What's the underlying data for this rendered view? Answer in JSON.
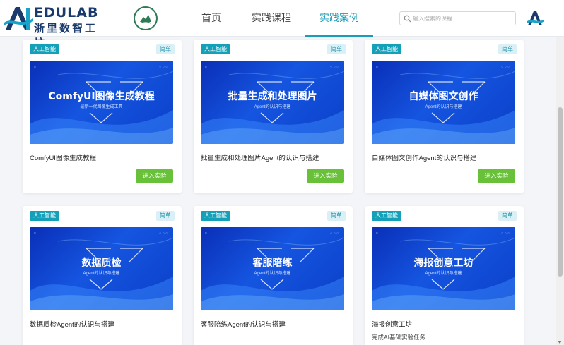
{
  "header": {
    "logo_en": "EDULAB",
    "logo_cn": "浙里数智工坊",
    "nav": [
      {
        "label": "首页",
        "active": false
      },
      {
        "label": "实践课程",
        "active": false
      },
      {
        "label": "实践案例",
        "active": true
      }
    ],
    "search_placeholder": "输入搜索的课程..."
  },
  "colors": {
    "accent": "#1b9cb8",
    "category_tag": "#14a0b8",
    "level_tag_bg": "#d9f1f6",
    "enter_button": "#69c13a",
    "cover_blue": "#1555e0"
  },
  "cards": [
    {
      "category": "人工智能",
      "level": "简单",
      "cover_title": "ComfyUI图像生成教程",
      "cover_subtitle": "——最新一代图像生成工具——",
      "title": "ComfyUI图像生成教程",
      "subtitle": "",
      "button": "进入实验"
    },
    {
      "category": "人工智能",
      "level": "简单",
      "cover_title": "批量生成和处理图片",
      "cover_subtitle": "Agent的认识与搭建",
      "title": "批量生成和处理图片Agent的认识与搭建",
      "subtitle": "",
      "button": "进入实验"
    },
    {
      "category": "人工智能",
      "level": "简单",
      "cover_title": "自媒体图文创作",
      "cover_subtitle": "Agent的认识与搭建",
      "title": "自媒体图文创作Agent的认识与搭建",
      "subtitle": "",
      "button": "进入实验"
    },
    {
      "category": "人工智能",
      "level": "简单",
      "cover_title": "数据质检",
      "cover_subtitle": "Agent的认识与搭建",
      "title": "数据质检Agent的认识与搭建",
      "subtitle": "",
      "button": ""
    },
    {
      "category": "人工智能",
      "level": "简单",
      "cover_title": "客服陪练",
      "cover_subtitle": "Agent的认识与搭建",
      "title": "客服陪练Agent的认识与搭建",
      "subtitle": "",
      "button": ""
    },
    {
      "category": "人工智能",
      "level": "简单",
      "cover_title": "海报创意工坊",
      "cover_subtitle": "Agent的认识与搭建",
      "title": "海报创意工坊",
      "subtitle": "完成AI基础实验任务",
      "button": ""
    }
  ]
}
